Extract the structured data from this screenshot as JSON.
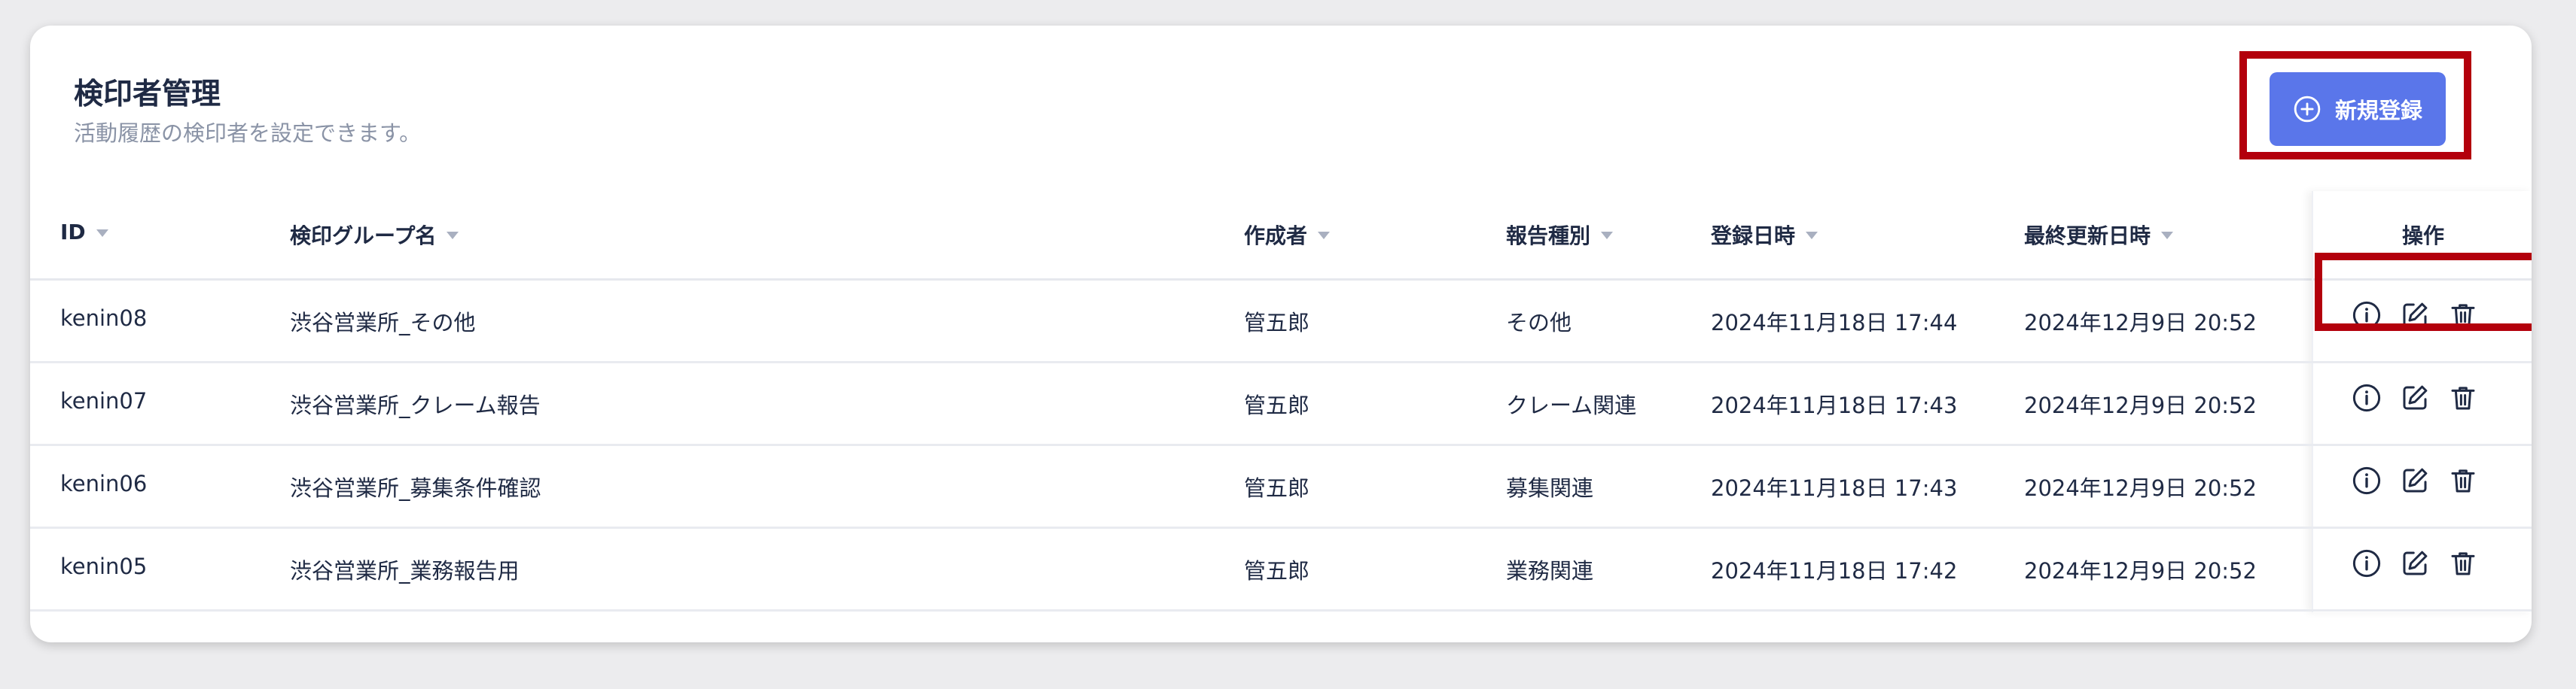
{
  "page": {
    "title": "検印者管理",
    "subtitle": "活動履歴の検印者を設定できます。"
  },
  "register_button": {
    "label": "新規登録"
  },
  "table": {
    "columns": [
      "ID",
      "検印グループ名",
      "作成者",
      "報告種別",
      "登録日時",
      "最終更新日時",
      "操作"
    ],
    "rows": [
      [
        "kenin08",
        "渋谷営業所_その他",
        "管五郎",
        "その他",
        "2024年11月18日 17:44",
        "2024年12月9日 20:52"
      ],
      [
        "kenin07",
        "渋谷営業所_クレーム報告",
        "管五郎",
        "クレーム関連",
        "2024年11月18日 17:43",
        "2024年12月9日 20:52"
      ],
      [
        "kenin06",
        "渋谷営業所_募集条件確認",
        "管五郎",
        "募集関連",
        "2024年11月18日 17:43",
        "2024年12月9日 20:52"
      ],
      [
        "kenin05",
        "渋谷営業所_業務報告用",
        "管五郎",
        "業務関連",
        "2024年11月18日 17:42",
        "2024年12月9日 20:52"
      ]
    ],
    "row_actions": [
      "info-icon",
      "edit-icon",
      "trash-icon"
    ]
  },
  "colors": {
    "accent": "#5a76ea",
    "highlight": "#b3000c",
    "text": "#1f2a44",
    "muted": "#8a93a6"
  }
}
